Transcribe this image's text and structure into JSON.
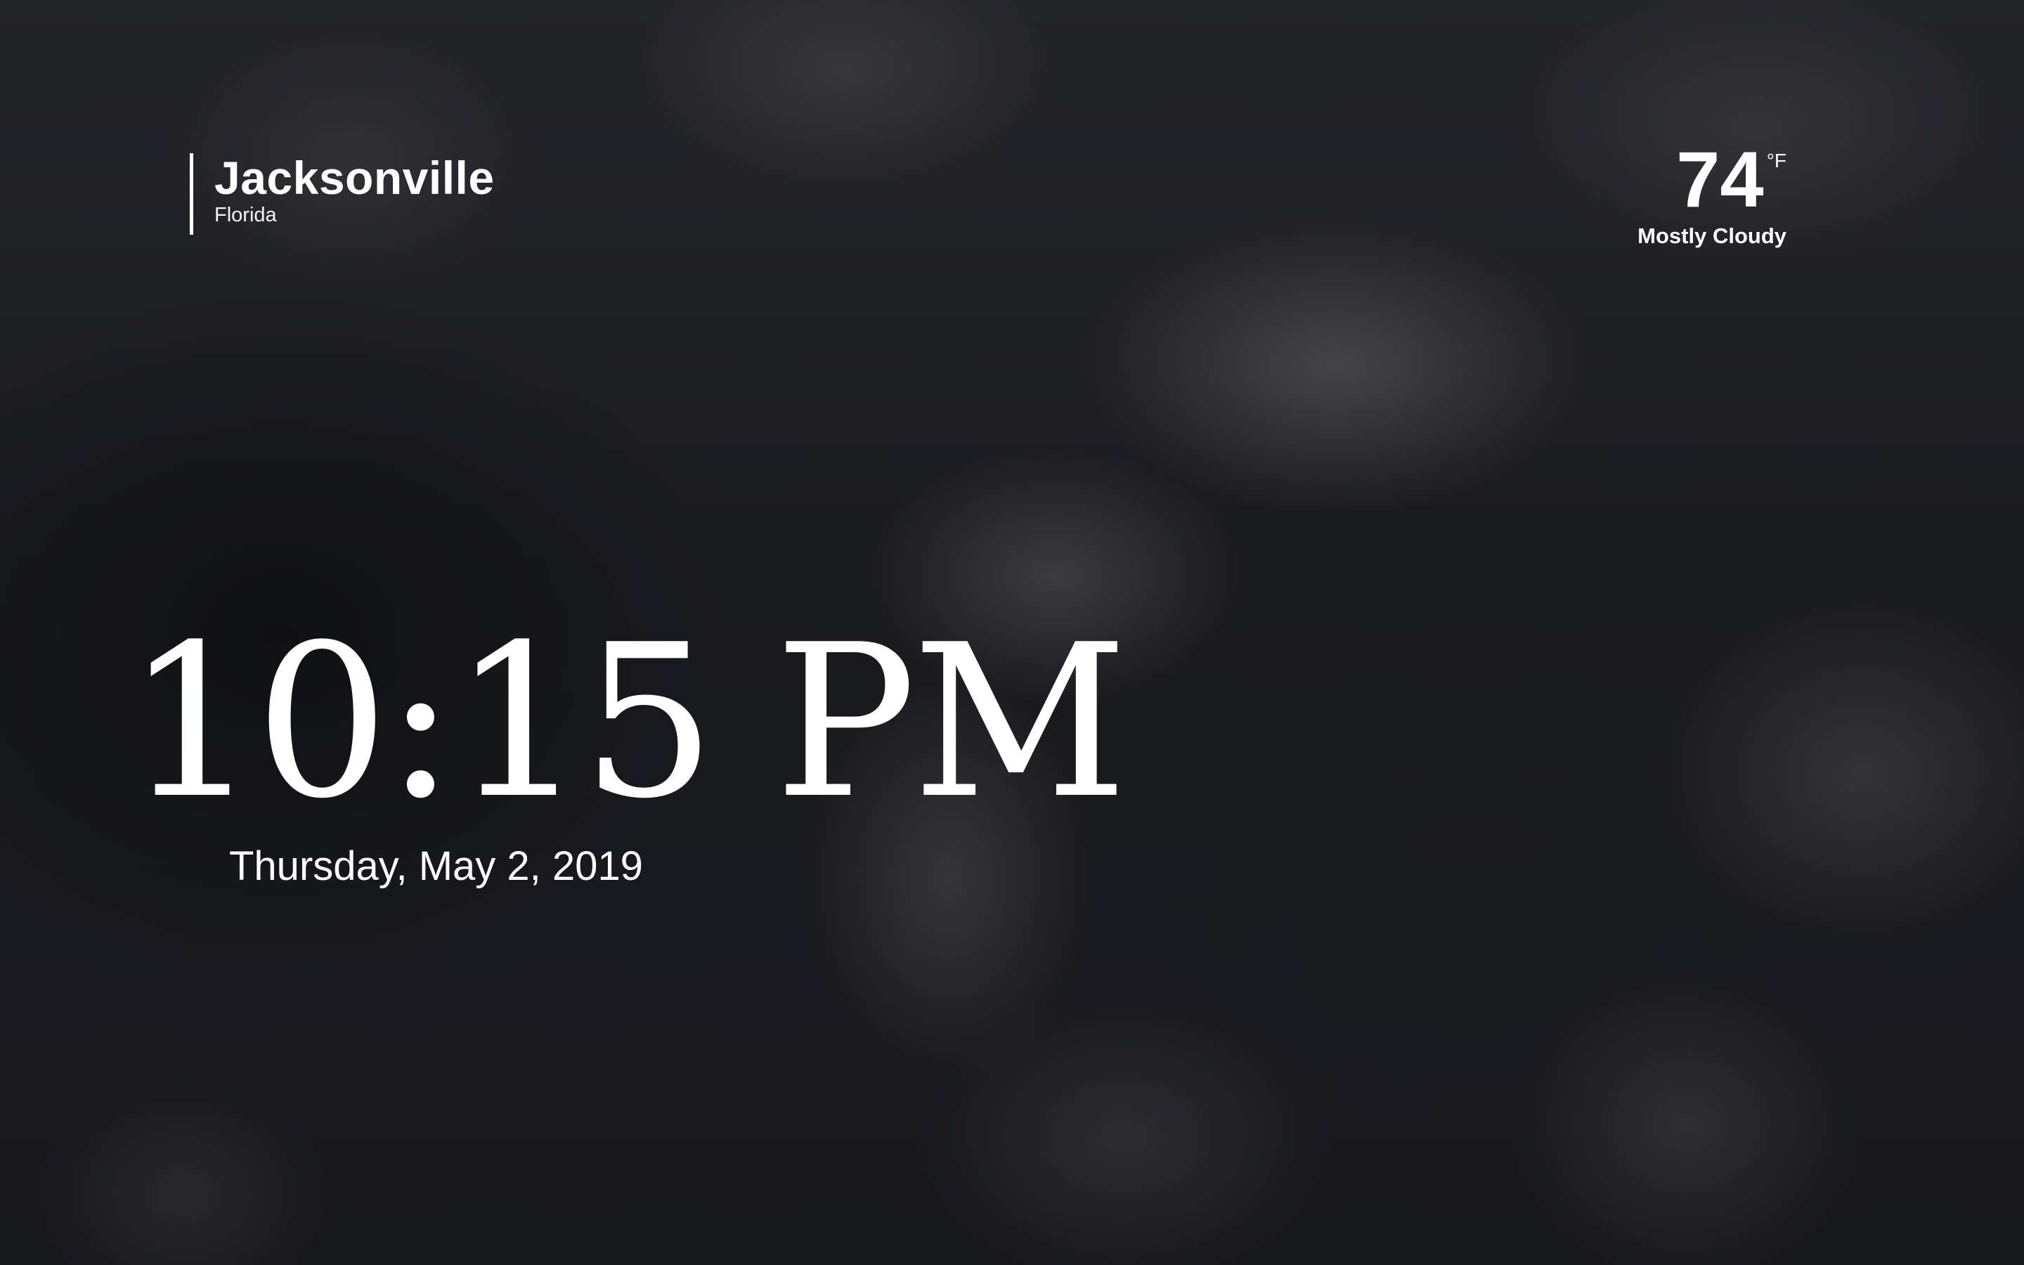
{
  "location": {
    "city": "Jacksonville",
    "state": "Florida"
  },
  "weather": {
    "temperature": "74",
    "unit": "°F",
    "condition": "Mostly Cloudy"
  },
  "clock": {
    "time": "10:15 PM",
    "date": "Thursday, May 2, 2019"
  },
  "colors": {
    "text": "#ffffff",
    "background": "#1c1d21"
  }
}
